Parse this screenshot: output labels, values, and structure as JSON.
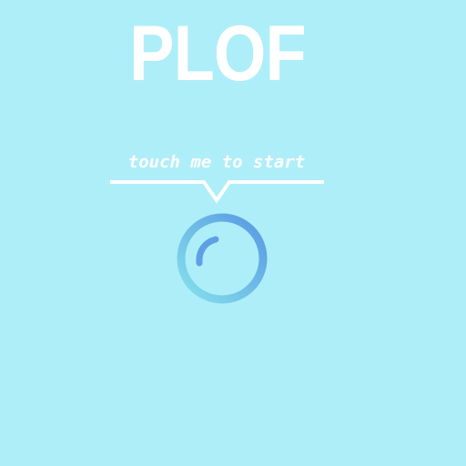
{
  "game": {
    "title": "PLOF",
    "prompt": "touch me to start"
  },
  "colors": {
    "background": "#aeeef9",
    "text": "#ffffff",
    "bubble_ring_light": "#7fdcea",
    "bubble_ring_dark": "#5f9fe5",
    "bubble_highlight": "#5f9fe5"
  },
  "icons": {
    "start_bubble": "bubble-icon",
    "bubble_shine": "bubble-highlight-icon",
    "prompt_pointer": "speech-pointer-icon"
  }
}
